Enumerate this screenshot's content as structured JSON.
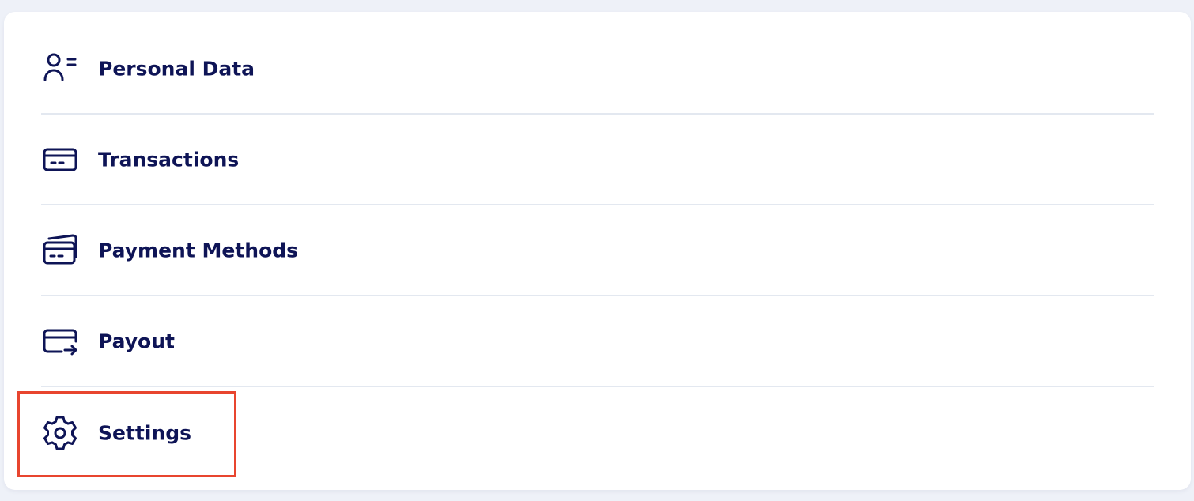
{
  "menu": {
    "items": [
      {
        "label": "Personal Data",
        "icon": "user-list-icon"
      },
      {
        "label": "Transactions",
        "icon": "card-icon"
      },
      {
        "label": "Payment Methods",
        "icon": "cards-stack-icon"
      },
      {
        "label": "Payout",
        "icon": "card-transfer-icon"
      },
      {
        "label": "Settings",
        "icon": "gear-icon"
      }
    ]
  },
  "highlight": {
    "target": "Settings",
    "color": "#e8452f"
  },
  "colors": {
    "text": "#0e1456",
    "divider": "#e3e8f0",
    "background": "#eef1f8",
    "card": "#ffffff"
  }
}
